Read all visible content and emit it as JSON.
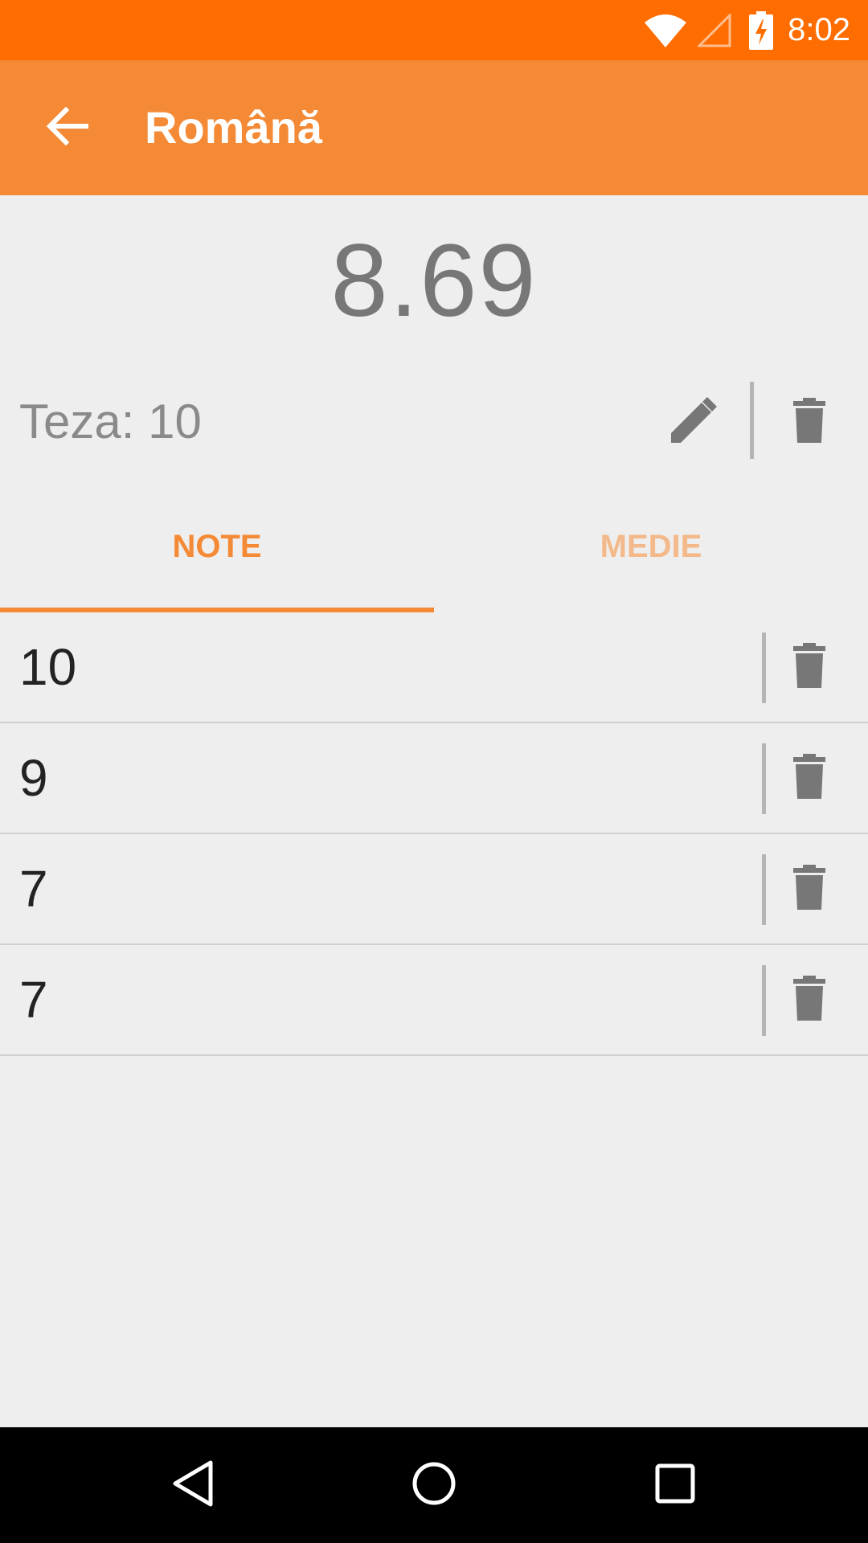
{
  "status_bar": {
    "time": "8:02",
    "icons": [
      "wifi-icon",
      "cell-signal-icon",
      "battery-charging-icon"
    ],
    "color": "#ff6d00"
  },
  "app_bar": {
    "title": "Română",
    "back_icon": "arrow-back-icon",
    "color": "#f48a36"
  },
  "average": "8.69",
  "teza": {
    "label": "Teza: 10",
    "edit_icon": "pencil-icon",
    "delete_icon": "trash-icon"
  },
  "tabs": [
    {
      "label": "NOTE",
      "selected": true
    },
    {
      "label": "MEDIE",
      "selected": false
    }
  ],
  "grades": [
    {
      "value": "10",
      "delete_icon": "trash-icon"
    },
    {
      "value": "9",
      "delete_icon": "trash-icon"
    },
    {
      "value": "7",
      "delete_icon": "trash-icon"
    },
    {
      "value": "7",
      "delete_icon": "trash-icon"
    }
  ],
  "nav_bar": {
    "icons": [
      "nav-back-icon",
      "nav-home-icon",
      "nav-recents-icon"
    ]
  }
}
